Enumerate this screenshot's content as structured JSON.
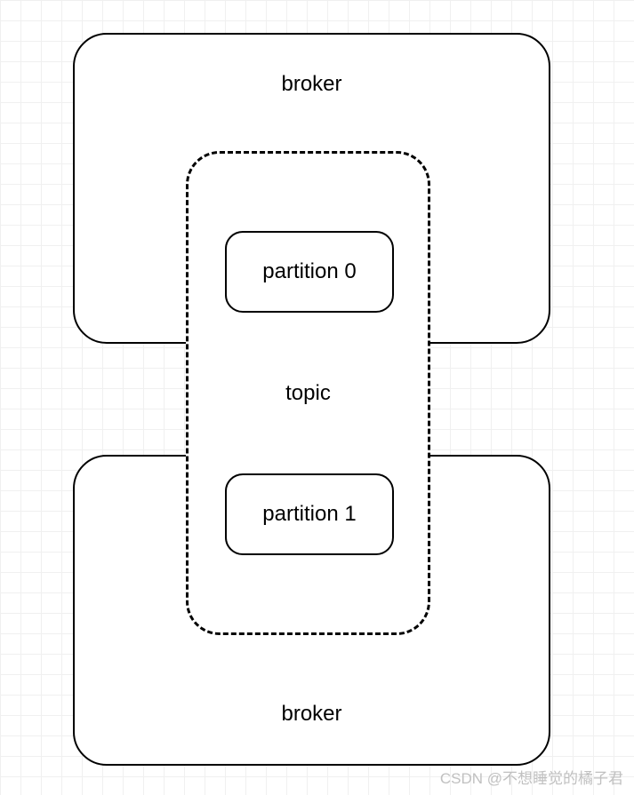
{
  "diagram": {
    "broker_top_label": "broker",
    "broker_bottom_label": "broker",
    "topic_label": "topic",
    "partition_0_label": "partition 0",
    "partition_1_label": "partition 1"
  },
  "watermark": "CSDN @不想睡觉的橘子君"
}
